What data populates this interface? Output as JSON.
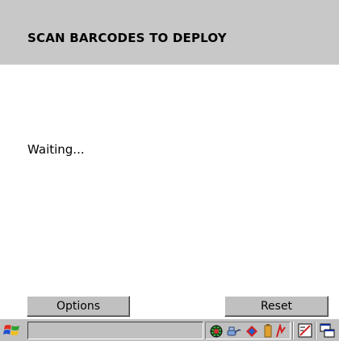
{
  "header": {
    "title": "SCAN BARCODES TO DEPLOY"
  },
  "main": {
    "status_text": "Waiting..."
  },
  "buttons": {
    "options_label": "Options",
    "reset_label": "Reset"
  },
  "taskbar": {
    "start_icon": "windows-flag-icon",
    "tray_icons": [
      "network-globe-icon",
      "connection-icon",
      "sync-icon",
      "battery-icon"
    ],
    "right_icons": [
      "input-panel-icon",
      "desktop-windows-icon"
    ]
  }
}
